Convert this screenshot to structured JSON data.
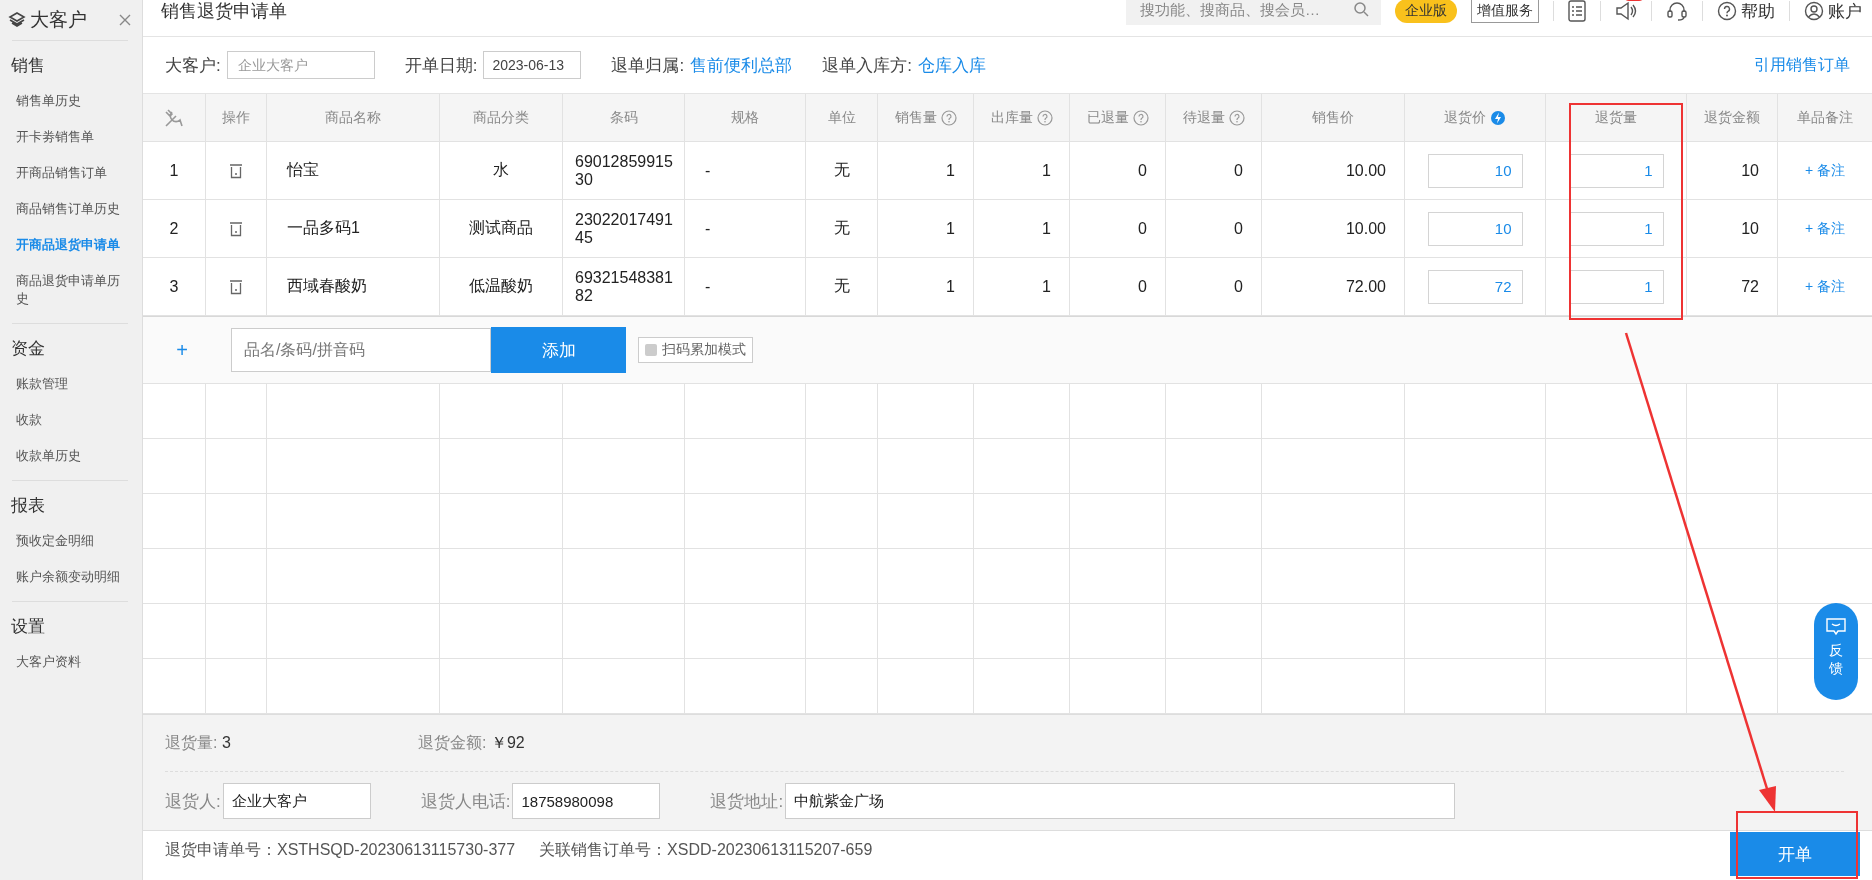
{
  "sidebar": {
    "title": "大客户",
    "sections": [
      {
        "title": "销售",
        "items": [
          {
            "label": "销售单历史",
            "selected": false
          },
          {
            "label": "开卡劵销售单",
            "selected": false
          },
          {
            "label": "开商品销售订单",
            "selected": false
          },
          {
            "label": "商品销售订单历史",
            "selected": false
          },
          {
            "label": "开商品退货申请单",
            "selected": true
          },
          {
            "label": "商品退货申请单历史",
            "selected": false
          }
        ]
      },
      {
        "title": "资金",
        "items": [
          {
            "label": "账款管理",
            "selected": false
          },
          {
            "label": "收款",
            "selected": false
          },
          {
            "label": "收款单历史",
            "selected": false
          }
        ]
      },
      {
        "title": "报表",
        "items": [
          {
            "label": "预收定金明细",
            "selected": false
          },
          {
            "label": "账户余额变动明细",
            "selected": false
          }
        ]
      },
      {
        "title": "设置",
        "items": [
          {
            "label": "大客户资料",
            "selected": false
          }
        ]
      }
    ]
  },
  "header": {
    "title": "销售退货申请单",
    "search": {
      "placeholder": "搜功能、搜商品、搜会员…"
    },
    "edition": "企业版",
    "service": "增值服务",
    "help": "帮助",
    "account": "账户"
  },
  "filters": [
    {
      "kind": "input",
      "label": "大客户:",
      "placeholder": "企业大客户"
    },
    {
      "kind": "date",
      "label": "开单日期:",
      "value": "2023-06-13"
    },
    {
      "kind": "link",
      "label": "退单归属:",
      "value": "售前便利总部"
    },
    {
      "kind": "link",
      "label": "退单入库方:",
      "value": "仓库入库"
    }
  ],
  "quote_link": "引用销售订单",
  "table": {
    "columns": [
      {
        "kind": "tool"
      },
      {
        "kind": "plain",
        "label": "操作"
      },
      {
        "kind": "plain",
        "label": "商品名称"
      },
      {
        "kind": "plain",
        "label": "商品分类"
      },
      {
        "kind": "plain",
        "label": "条码"
      },
      {
        "kind": "plain",
        "label": "规格"
      },
      {
        "kind": "plain",
        "label": "单位"
      },
      {
        "kind": "help",
        "label": "销售量"
      },
      {
        "kind": "help",
        "label": "出库量"
      },
      {
        "kind": "help",
        "label": "已退量"
      },
      {
        "kind": "help",
        "label": "待退量"
      },
      {
        "kind": "plain",
        "label": "销售价"
      },
      {
        "kind": "bolt",
        "label": "退货价"
      },
      {
        "kind": "plain",
        "label": "退货量"
      },
      {
        "kind": "plain",
        "label": "退货金额"
      },
      {
        "kind": "plain",
        "label": "单品备注"
      }
    ],
    "rows": [
      {
        "index": "1",
        "name": "怡宝",
        "category": "水",
        "barcode": "6901285991530",
        "spec": "-",
        "unit": "无",
        "sold": "1",
        "shipped": "1",
        "returned": "0",
        "pending": "0",
        "price": "10.00",
        "return_price": "10",
        "return_qty": "1",
        "amount": "10",
        "note": "+ 备注"
      },
      {
        "index": "2",
        "name": "一品多码1",
        "category": "测试商品",
        "barcode": "2302201749145",
        "spec": "-",
        "unit": "无",
        "sold": "1",
        "shipped": "1",
        "returned": "0",
        "pending": "0",
        "price": "10.00",
        "return_price": "10",
        "return_qty": "1",
        "amount": "10",
        "note": "+ 备注"
      },
      {
        "index": "3",
        "name": "西域春酸奶",
        "category": "低温酸奶",
        "barcode": "6932154838182",
        "spec": "-",
        "unit": "无",
        "sold": "1",
        "shipped": "1",
        "returned": "0",
        "pending": "0",
        "price": "72.00",
        "return_price": "72",
        "return_qty": "1",
        "amount": "72",
        "note": "+ 备注"
      }
    ]
  },
  "add_row": {
    "plus": "+",
    "placeholder": "品名/条码/拼音码",
    "button": "添加",
    "scan_mode": {
      "label": "扫码累加模式",
      "checked": false
    }
  },
  "summary": [
    {
      "label": "退货量:",
      "value": "3"
    },
    {
      "label": "退货金额:",
      "value": "￥92"
    }
  ],
  "contact": [
    {
      "label": "退货人:",
      "value": "企业大客户",
      "kind": "short"
    },
    {
      "label": "退货人电话:",
      "value": "18758980098",
      "kind": "short"
    },
    {
      "label": "退货地址:",
      "value": "中航紫金广场",
      "kind": "long"
    }
  ],
  "footer": {
    "numbers": [
      {
        "label": "退货申请单号：",
        "value": "XSTHSQD-20230613115730-377"
      },
      {
        "label": "关联销售订单号：",
        "value": "XSDD-20230613115207-659"
      }
    ],
    "submit": "开单"
  },
  "feedback": "反馈"
}
